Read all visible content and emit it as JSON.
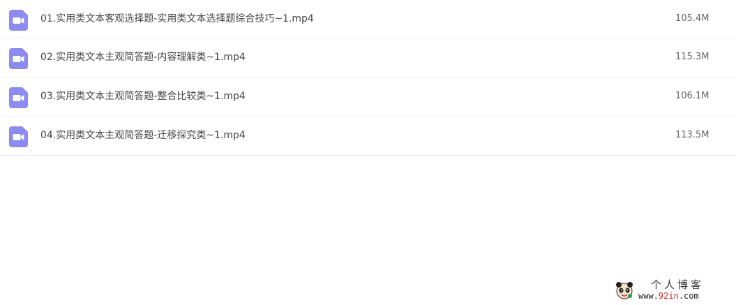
{
  "files": [
    {
      "name": "01.实用类文本客观选择题-实用类文本选择题综合技巧~1.mp4",
      "size": "105.4M",
      "icon": "video-file-icon"
    },
    {
      "name": "02.实用类文本主观简答题-内容理解类~1.mp4",
      "size": "115.3M",
      "icon": "video-file-icon"
    },
    {
      "name": "03.实用类文本主观简答题-整合比较类~1.mp4",
      "size": "106.1M",
      "icon": "video-file-icon"
    },
    {
      "name": "04.实用类文本主观简答题-迁移探究类~1.mp4",
      "size": "113.5M",
      "icon": "video-file-icon"
    }
  ],
  "watermark": {
    "title": "个人博客",
    "url_prefix": "www.",
    "url_accent": "92in",
    "url_suffix": ".com"
  },
  "colors": {
    "icon_fill": "#8c8cf0",
    "url_accent": "#d62b2b"
  }
}
